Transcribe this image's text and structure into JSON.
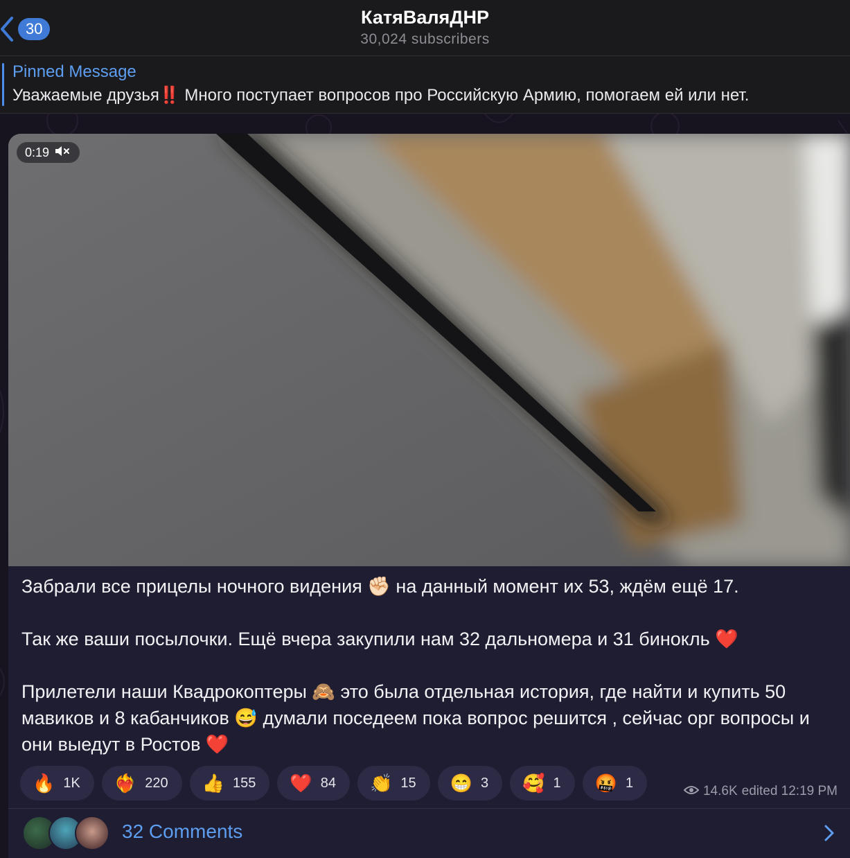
{
  "header": {
    "back_count": "30",
    "title": "КатяВаляДНР",
    "subtitle": "30,024 subscribers"
  },
  "pinned": {
    "label": "Pinned Message",
    "text": "Уважаемые друзья‼️ Много поступает вопросов про Российскую Армию, помогаем ей или нет."
  },
  "video": {
    "duration": "0:19",
    "muted_icon": "speaker-muted-icon"
  },
  "message": {
    "text": "Забрали все прицелы ночного видения ✊🏻 на данный момент их 53, ждём ещё 17.\n\nТак же ваши посылочки. Ещё вчера закупили нам 32 дальномера и 31 бинокль ❤️\n\nПрилетели наши Квадрокоптеры 🙈 это была отдельная история, где найти и купить 50 мавиков и 8 кабанчиков 😅 думали поседеем пока вопрос решится , сейчас орг вопросы и они выедут в Ростов ❤️",
    "views": "14.6K",
    "edited": "edited 12:19 PM"
  },
  "reactions": [
    {
      "emoji": "🔥",
      "count": "1K"
    },
    {
      "emoji": "❤️‍🔥",
      "count": "220"
    },
    {
      "emoji": "👍",
      "count": "155"
    },
    {
      "emoji": "❤️",
      "count": "84"
    },
    {
      "emoji": "👏",
      "count": "15"
    },
    {
      "emoji": "😁",
      "count": "3"
    },
    {
      "emoji": "🥰",
      "count": "1"
    },
    {
      "emoji": "🤬",
      "count": "1"
    }
  ],
  "comments": {
    "label": "32 Comments"
  },
  "colors": {
    "accent": "#4c8ee9",
    "bubble": "#1f1d32",
    "reaction_bg": "#2c2a44"
  }
}
